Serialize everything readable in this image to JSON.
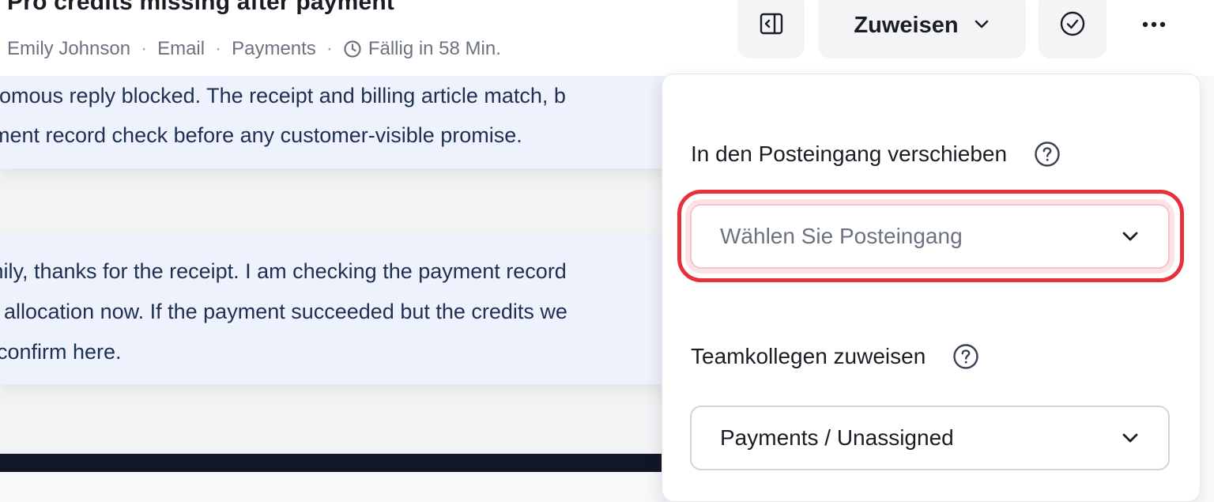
{
  "ticket": {
    "title": "Pro credits missing after payment",
    "customer": "Emily Johnson",
    "channel": "Email",
    "queue": "Payments",
    "due": "Fällig in 58 Min."
  },
  "header_actions": {
    "panel_toggle_icon": "panel-toggle-icon",
    "assign_label": "Zuweisen",
    "resolve_icon": "check-circle-icon",
    "more_icon": "more-horizontal-icon"
  },
  "conversation": {
    "ai_note": {
      "line1": "nomous reply blocked. The receipt and billing article match, b",
      "line2": "ment record check before any customer-visible promise."
    },
    "reply": {
      "line1": "mily, thanks for the receipt. I am checking the payment record",
      "line2": "t allocation now. If the payment succeeded but the credits we",
      "line3": "confirm here."
    }
  },
  "assign_panel": {
    "inbox_section": {
      "label": "In den Posteingang verschieben",
      "placeholder": "Wählen Sie Posteingang"
    },
    "teammate_section": {
      "label": "Teamkollegen zuweisen",
      "value": "Payments / Unassigned"
    }
  },
  "colors": {
    "highlight": "#e8303a",
    "note_background": "#eef2fc",
    "composer_bar": "#121727"
  }
}
